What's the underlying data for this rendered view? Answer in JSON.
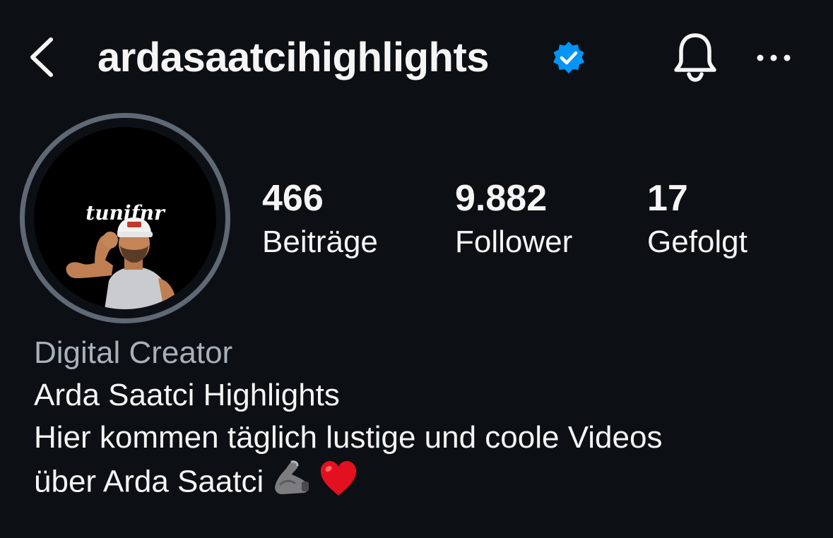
{
  "header": {
    "username": "ardasaatcihighlights",
    "verified": true,
    "icons": {
      "back": "chevron-left-icon",
      "verified": "verified-badge-icon",
      "notifications": "bell-icon",
      "more": "more-horizontal-icon"
    }
  },
  "profile": {
    "avatar_text": "tunifnr",
    "stats": [
      {
        "value": "466",
        "label": "Beiträge"
      },
      {
        "value": "9.882",
        "label": "Follower"
      },
      {
        "value": "17",
        "label": "Gefolgt"
      }
    ]
  },
  "bio": {
    "category": "Digital Creator",
    "name": "Arda Saatci Highlights",
    "line1": "Hier kommen täglich lustige und coole Videos",
    "line2": "über Arda Saatci",
    "emojis": [
      "flexed-biceps-icon",
      "red-heart-icon"
    ]
  },
  "colors": {
    "background": "#0c1014",
    "text": "#f5f5f5",
    "secondary_text": "#a8b0ba",
    "verified_blue": "#0095f6",
    "avatar_ring": "#5f6975",
    "heart_red": "#e3101f"
  }
}
